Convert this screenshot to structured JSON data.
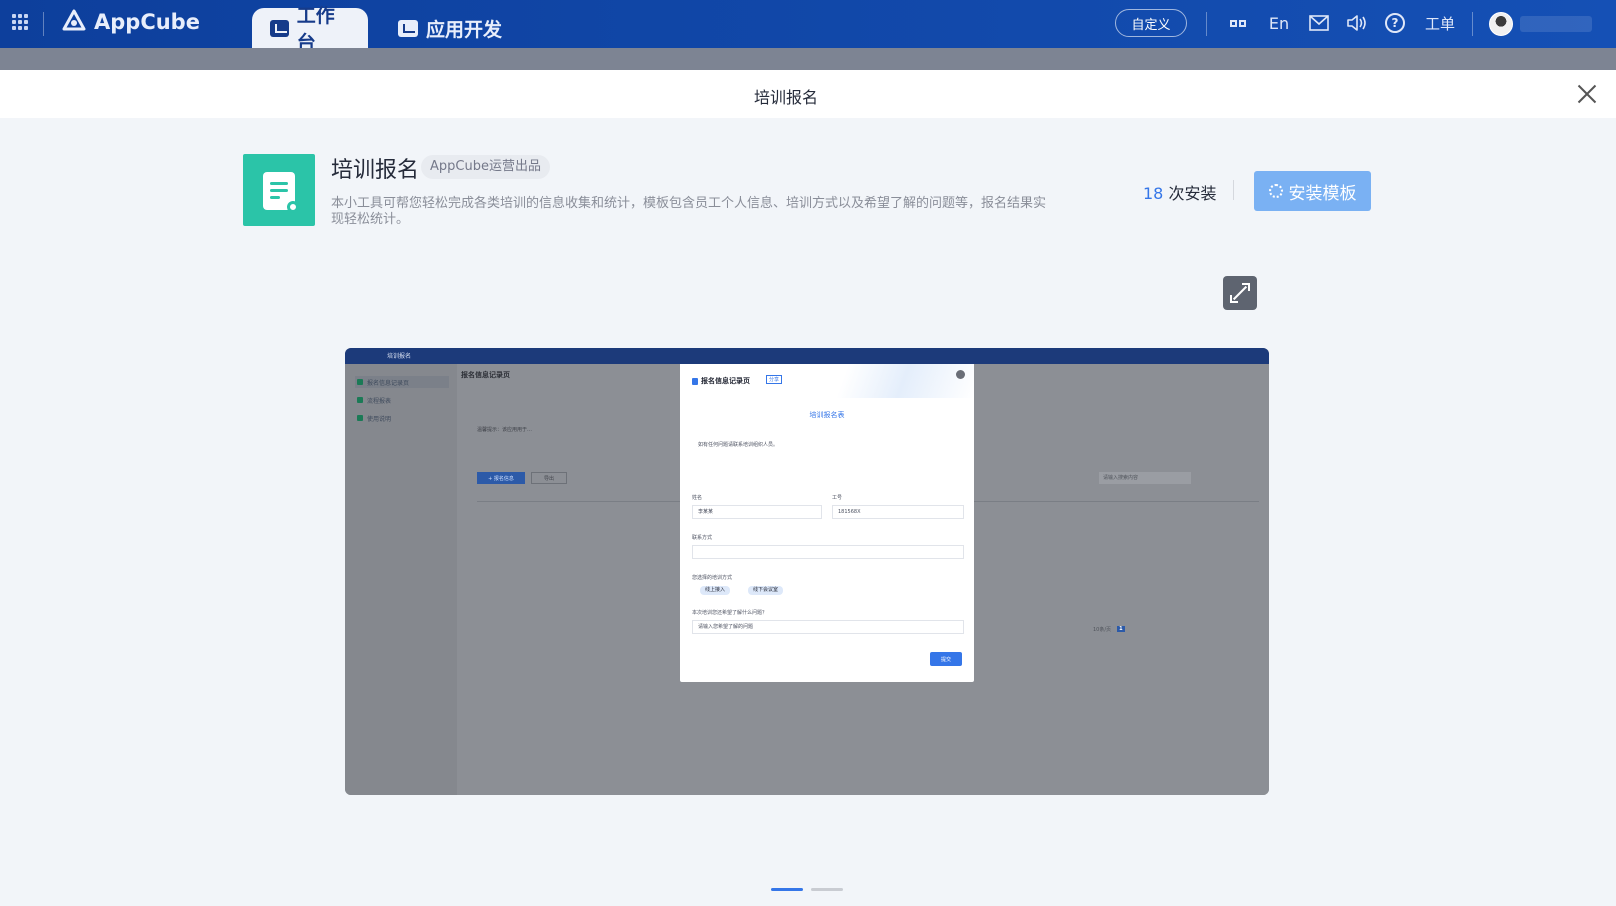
{
  "topbar": {
    "logo": "AppCube",
    "tabs": [
      {
        "label": "工作台",
        "icon": "monitor-icon",
        "active": true
      },
      {
        "label": "应用开发",
        "icon": "code-icon",
        "active": false
      }
    ],
    "custom_button": "自定义",
    "lang": "En",
    "work_order": "工单"
  },
  "drawer": {
    "title": "培训报名"
  },
  "app": {
    "name": "培训报名",
    "badge": "AppCube运营出品",
    "description": "本小工具可帮您轻松完成各类培训的信息收集和统计，模板包含员工个人信息、培训方式以及希望了解的问题等，报名结果实现轻松统计。",
    "install_count": "18",
    "install_suffix": " 次安装",
    "install_button": "安装模板",
    "accent_color": "#3576e8",
    "icon_color": "#2bc4a8"
  },
  "preview_shot": {
    "app_title": "培训报名",
    "sidebar": [
      "报名信息记录页",
      "流程报表",
      "使用说明"
    ],
    "page_heading": "报名信息记录页",
    "notice": "温馨提示：该应用用于…",
    "add_button": "+ 报名信息",
    "export_button": "导出",
    "search_placeholder": "请输入搜索内容",
    "pager_size": "10条/页",
    "pager_current": "1",
    "modal": {
      "title": "报名信息记录页",
      "tag": "分享",
      "form_title": "培训报名表",
      "intro": "如有任何问题请联系培训组织人员。",
      "field_name": "姓名",
      "name_value": "李某某",
      "field_id": "工号",
      "id_value": "181568X",
      "field_contact": "联系方式",
      "field_method": "您选择的培训方式",
      "option_online": "线上接入",
      "option_offline": "线下会议室",
      "field_question": "本次培训您还希望了解什么问题？",
      "question_placeholder": "请输入您希望了解的问题",
      "submit": "提交"
    }
  }
}
